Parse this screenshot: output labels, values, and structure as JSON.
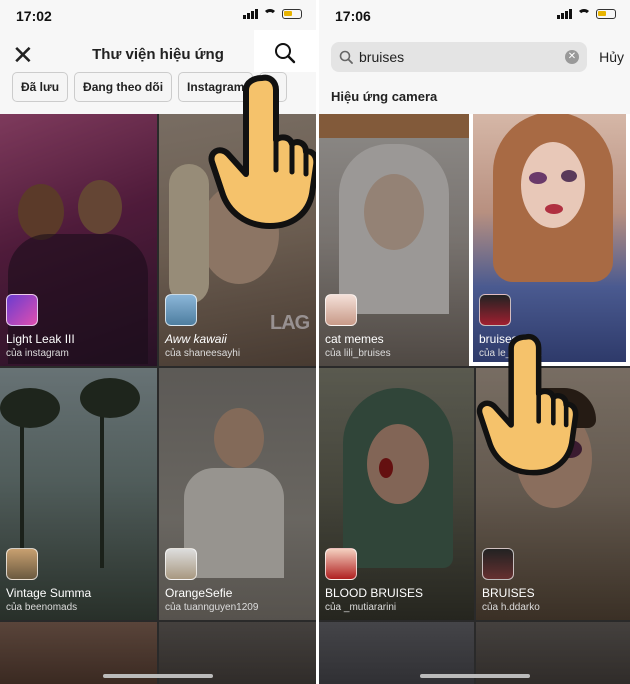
{
  "left": {
    "status": {
      "time": "17:02"
    },
    "header": {
      "title": "Thư viện hiệu ứng"
    },
    "chips": [
      "Đã lưu",
      "Đang theo dõi",
      "Instagram",
      "ie"
    ],
    "effects": [
      {
        "name": "Light Leak III",
        "creator": "của instagram"
      },
      {
        "name": "Aww kawaii",
        "creator": "của shaneesayhi"
      },
      {
        "name": "Vintage Summa",
        "creator": "của beenomads"
      },
      {
        "name": "OrangeSefie",
        "creator": "của tuannguyen1209"
      }
    ],
    "watermark": "LAG"
  },
  "right": {
    "status": {
      "time": "17:06"
    },
    "search": {
      "query": "bruises",
      "cancel": "Hủy"
    },
    "section_title": "Hiệu ứng camera",
    "effects": [
      {
        "name": "cat memes",
        "creator": "của lili_bruises"
      },
      {
        "name": "bruises",
        "creator": "của le_a...ova"
      },
      {
        "name": "BLOOD BRUISES",
        "creator": "của _mutiararini"
      },
      {
        "name": "BRUISES",
        "creator": "của h.ddarko"
      }
    ]
  },
  "colors": {
    "hand": "#f5c26b",
    "hand_outline": "#111111"
  }
}
